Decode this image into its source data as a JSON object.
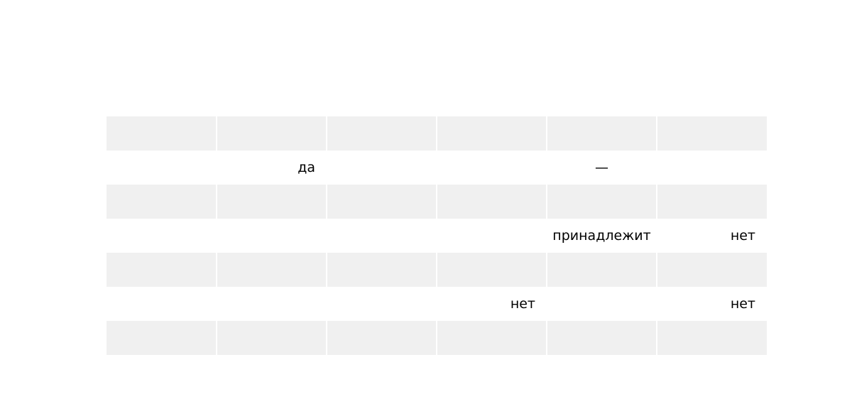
{
  "table": {
    "rows": [
      [
        "",
        "",
        "",
        "",
        "",
        ""
      ],
      [
        "",
        "да",
        "",
        "",
        "—",
        ""
      ],
      [
        "",
        "",
        "",
        "",
        "",
        ""
      ],
      [
        "",
        "",
        "",
        "",
        "принадлежит",
        "нет"
      ],
      [
        "",
        "",
        "",
        "",
        "",
        ""
      ],
      [
        "",
        "",
        "",
        "нет",
        "",
        "нет"
      ],
      [
        "",
        "",
        "",
        "",
        "",
        ""
      ]
    ]
  }
}
